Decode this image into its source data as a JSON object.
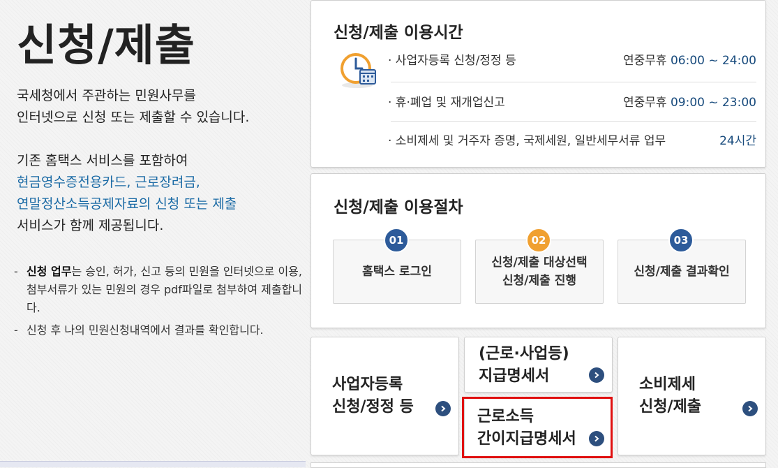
{
  "page": {
    "title": "신청/제출",
    "intro_line1": "국세청에서 주관하는 민원사무를",
    "intro_line2": "인터넷으로 신청 또는 제출할 수 있습니다.",
    "intro_line3": "기존 홈택스 서비스를 포함하여",
    "intro_blue1": "현금영수증전용카드, 근로장려금,",
    "intro_blue2": "연말정산소득공제자료의 신청 또는 제출",
    "intro_line4": "서비스가 함께 제공됩니다."
  },
  "notes": {
    "note1_bold": "신청 업무",
    "note1_text": "는 승인, 허가, 신고 등의 민원을 인터넷으로 이용, 첨부서류가 있는 민원의 경우 pdf파일로 첨부하여 제출합니다.",
    "note2_text": "신청 후 나의 민원신청내역에서 결과를 확인합니다."
  },
  "hours": {
    "title": "신청/제출 이용시간",
    "rows": [
      {
        "label": "· 사업자등록 신청/정정 등",
        "prefix": "연중무휴 ",
        "time": "06:00 ~ 24:00"
      },
      {
        "label": "· 휴·폐업 및 재개업신고",
        "prefix": "연중무휴 ",
        "time": "09:00 ~ 23:00"
      },
      {
        "label": "· 소비제세 및 거주자 증명, 국제세원, 일반세무서류 업무",
        "prefix": "",
        "time": "24시간"
      }
    ]
  },
  "procedure": {
    "title": "신청/제출 이용절차",
    "steps": [
      {
        "num": "01",
        "label": "홈택스 로그인",
        "color": "#2d5b9a"
      },
      {
        "num": "02",
        "label": "신청/제출 대상선택\n신청/제출 진행",
        "color": "#f0a030"
      },
      {
        "num": "03",
        "label": "신청/제출 결과확인",
        "color": "#2d5b9a"
      }
    ]
  },
  "services": {
    "business": "사업자등록\n신청/정정 등",
    "payment_statement": "(근로·사업등)\n지급명세서",
    "simple_statement": "근로소득\n간이지급명세서",
    "consumption": "소비제세\n신청/제출"
  },
  "colors": {
    "accent_blue": "#1a6aa5",
    "arrow_navy": "#2d4f7e",
    "highlight_red": "#e01010",
    "step_orange": "#f0a030"
  }
}
